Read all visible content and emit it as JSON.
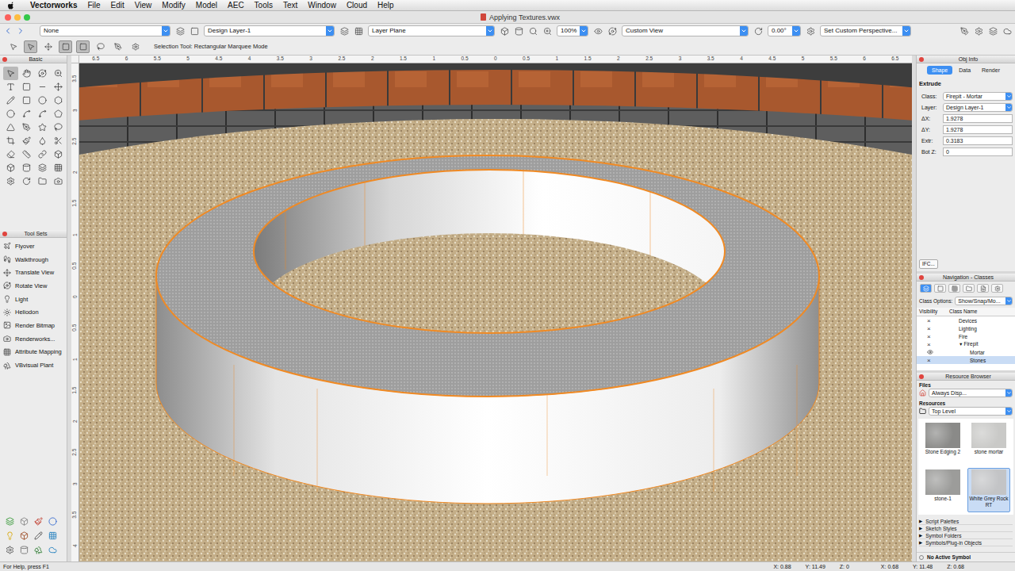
{
  "menubar": {
    "app": "Vectorworks",
    "items": [
      "File",
      "Edit",
      "View",
      "Modify",
      "Model",
      "AEC",
      "Tools",
      "Text",
      "Window",
      "Cloud",
      "Help"
    ]
  },
  "window": {
    "title": "Applying Textures.vwx"
  },
  "view_bar": {
    "class_value": "None",
    "layer_value": "Design Layer-1",
    "plane_value": "Layer Plane",
    "zoom_value": "100%",
    "view_value": "Custom View",
    "rotation_value": "0.00°",
    "perspective_value": "Set Custom Perspective..."
  },
  "mode_bar": {
    "modes": [
      {
        "selected": false
      },
      {
        "selected": true
      },
      {
        "selected": false
      },
      {
        "selected": true
      },
      {
        "selected": true
      },
      {
        "selected": false
      },
      {
        "selected": false
      },
      {
        "selected": false
      }
    ],
    "hint": "Selection Tool: Rectangular Marquee Mode"
  },
  "basic_palette": {
    "title": "Basic",
    "tools": [
      {
        "selected": true
      },
      {
        "selected": false
      },
      {
        "selected": false
      },
      {
        "selected": false
      },
      {
        "selected": false
      },
      {
        "selected": false
      },
      {
        "selected": false
      },
      {
        "selected": false
      },
      {
        "selected": false
      },
      {
        "selected": false
      },
      {
        "selected": false
      },
      {
        "selected": false
      },
      {
        "selected": false
      },
      {
        "selected": false
      },
      {
        "selected": false
      },
      {
        "selected": false
      },
      {
        "selected": false
      },
      {
        "selected": false
      },
      {
        "selected": false
      },
      {
        "selected": false
      },
      {
        "selected": false
      },
      {
        "selected": false
      },
      {
        "selected": false
      },
      {
        "selected": false
      },
      {
        "selected": false
      },
      {
        "selected": false
      },
      {
        "selected": false
      },
      {
        "selected": false
      },
      {
        "selected": false
      },
      {
        "selected": false
      },
      {
        "selected": false
      },
      {
        "selected": false
      },
      {
        "selected": false
      },
      {
        "selected": false
      },
      {
        "selected": false
      },
      {
        "selected": false
      }
    ]
  },
  "tool_sets": {
    "title": "Tool Sets",
    "items": [
      "Flyover",
      "Walkthrough",
      "Translate View",
      "Rotate View",
      "Light",
      "Heliodon",
      "Render Bitmap",
      "Renderworks...",
      "Attribute Mapping",
      "VBvisual Plant"
    ]
  },
  "rulers": {
    "top": [
      "6.5",
      "6",
      "5.5",
      "5",
      "4.5",
      "4",
      "3.5",
      "3",
      "2.5",
      "2",
      "1.5",
      "1",
      "0.5",
      "0",
      "0.5",
      "1",
      "1.5",
      "2",
      "2.5",
      "3",
      "3.5",
      "4",
      "4.5",
      "5",
      "5.5",
      "6",
      "6.5"
    ],
    "left": [
      "3.5",
      "3",
      "2.5",
      "2",
      "1.5",
      "1",
      "0.5",
      "0",
      "0.5",
      "1",
      "1.5",
      "2",
      "2.5",
      "3",
      "3.5",
      "4"
    ]
  },
  "obj_info": {
    "title": "Obj Info",
    "tabs": [
      {
        "label": "Shape",
        "selected": true
      },
      {
        "label": "Data",
        "selected": false
      },
      {
        "label": "Render",
        "selected": false
      }
    ],
    "object_type": "Extrude",
    "fields": [
      {
        "label": "Class:",
        "value": "Firepit - Mortar",
        "kind": "dropdown"
      },
      {
        "label": "Layer:",
        "value": "Design Layer-1",
        "kind": "dropdown"
      },
      {
        "label": "ΔX:",
        "value": "1.9278",
        "kind": "field"
      },
      {
        "label": "ΔY:",
        "value": "1.9278",
        "kind": "field"
      },
      {
        "label": "Extr:",
        "value": "0.3183",
        "kind": "field"
      },
      {
        "label": "Bot Z:",
        "value": "0",
        "kind": "field"
      }
    ],
    "ifc_button": "IFC..."
  },
  "navigation": {
    "title": "Navigation - Classes",
    "tools": [
      {
        "selected": true
      },
      {
        "selected": false
      },
      {
        "selected": false
      },
      {
        "selected": false
      },
      {
        "selected": false
      },
      {
        "selected": false
      }
    ],
    "options_label": "Class Options:",
    "options_value": "Show/Snap/Mo...",
    "columns": [
      "Visibility",
      "Class Name"
    ],
    "hidden_mark": "×",
    "rows": [
      {
        "name": "Devices",
        "visible": false,
        "depth": 1,
        "toggle": "",
        "selected": false
      },
      {
        "name": "Lighting",
        "visible": false,
        "depth": 1,
        "toggle": "",
        "selected": false
      },
      {
        "name": "Fire",
        "visible": false,
        "depth": 1,
        "toggle": "",
        "selected": false
      },
      {
        "name": "Firepit",
        "visible": false,
        "depth": 1,
        "toggle": "▼",
        "selected": false
      },
      {
        "name": "Mortar",
        "visible": true,
        "depth": 2,
        "toggle": "",
        "selected": false
      },
      {
        "name": "Stones",
        "visible": false,
        "depth": 2,
        "toggle": "",
        "selected": true
      }
    ]
  },
  "resource_browser": {
    "title": "Resource Browser",
    "files_label": "Files",
    "files_value": "Always Disp...",
    "resources_label": "Resources",
    "resources_value": "Top Level",
    "items": [
      {
        "label": "Stone Edging 2",
        "selected": false,
        "color": "#8a8a88"
      },
      {
        "label": "stone mortar",
        "selected": false,
        "color": "#c9c9c7"
      },
      {
        "label": "stone-1",
        "selected": false,
        "color": "#9c9c9a"
      },
      {
        "label": "White Grey Rock RT",
        "selected": true,
        "color": "#c3c4c6"
      }
    ],
    "sections": [
      {
        "label": "Script Palettes",
        "toggle": "▶"
      },
      {
        "label": "Sketch Styles",
        "toggle": "▶"
      },
      {
        "label": "Symbol Folders",
        "toggle": "▶"
      },
      {
        "label": "Symbols/Plug-in Objects",
        "toggle": "▶"
      }
    ],
    "footer": "No Active Symbol"
  },
  "status_bar": {
    "help": "For Help, press F1",
    "coords": [
      [
        "X: 0.88",
        "Y: 11.49",
        "Z: 0"
      ],
      [
        "X: 0.68",
        "Y: 11.48",
        "Z: 0.68"
      ]
    ]
  }
}
